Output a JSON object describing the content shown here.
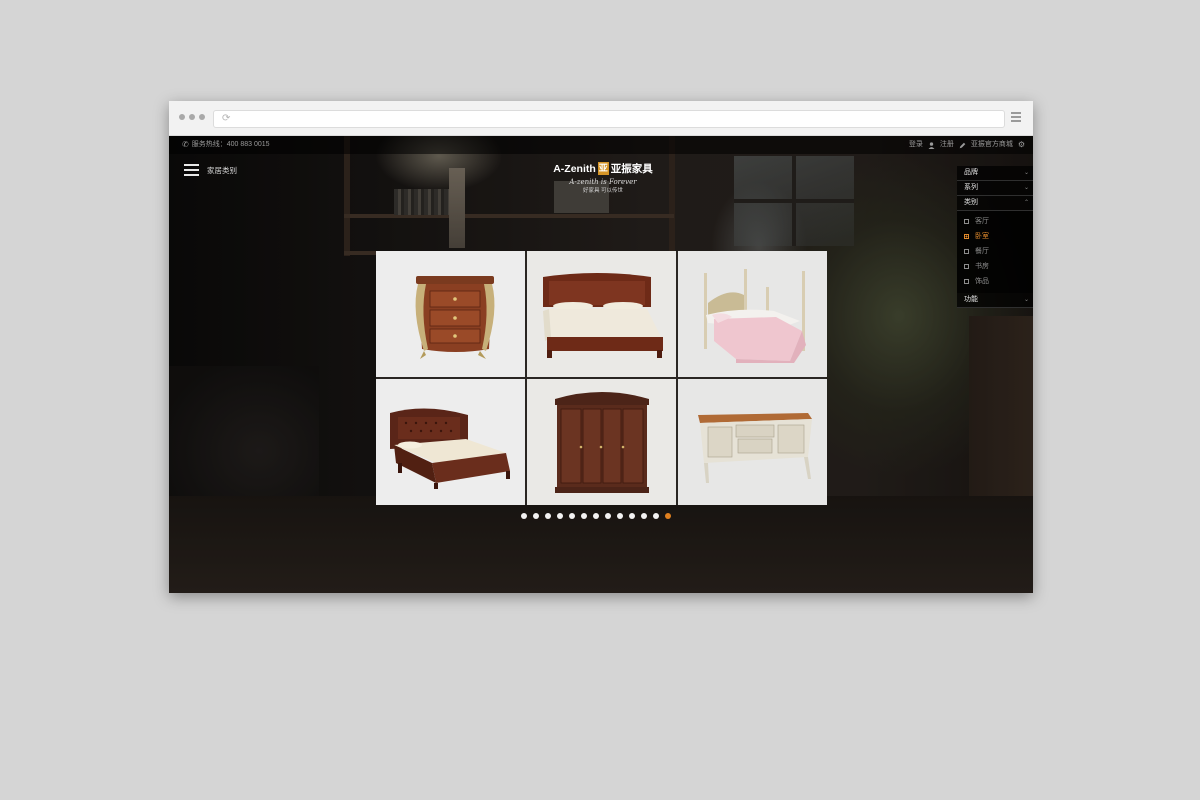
{
  "colors": {
    "accent": "#e0801f",
    "page_bg": "#d5d5d5",
    "top_bar": "#000000",
    "logo_mark": "#d59426"
  },
  "topbar": {
    "hotline_label": "服务热线：400 883 0015",
    "login": "登录",
    "register": "注册",
    "official_store": "亚振官方商城"
  },
  "header": {
    "menu_label": "家居类别",
    "logo": {
      "name_en": "A-Zenith",
      "mark": "亚",
      "name_cn": "亚振家具",
      "tagline": "A-zenith is Forever",
      "slogan": "好家具 可以传世"
    }
  },
  "filter": {
    "brand": "品牌",
    "series": "系列",
    "category": "类别",
    "options": [
      {
        "label": "客厅",
        "selected": false
      },
      {
        "label": "卧室",
        "selected": true
      },
      {
        "label": "餐厅",
        "selected": false
      },
      {
        "label": "书房",
        "selected": false
      },
      {
        "label": "饰品",
        "selected": false
      }
    ],
    "function": "功能"
  },
  "products": [
    {
      "name": "nightstand"
    },
    {
      "name": "bed-mahogany"
    },
    {
      "name": "poster-bed"
    },
    {
      "name": "leather-tufted-bed"
    },
    {
      "name": "wardrobe"
    },
    {
      "name": "sideboard"
    }
  ],
  "pagination": {
    "total": 13,
    "active_index": 12
  },
  "icons": [
    "phone-icon",
    "user-icon",
    "edit-icon",
    "gear-icon",
    "menu-icon",
    "reload-icon",
    "chevron-down-icon",
    "checkbox-icon"
  ]
}
